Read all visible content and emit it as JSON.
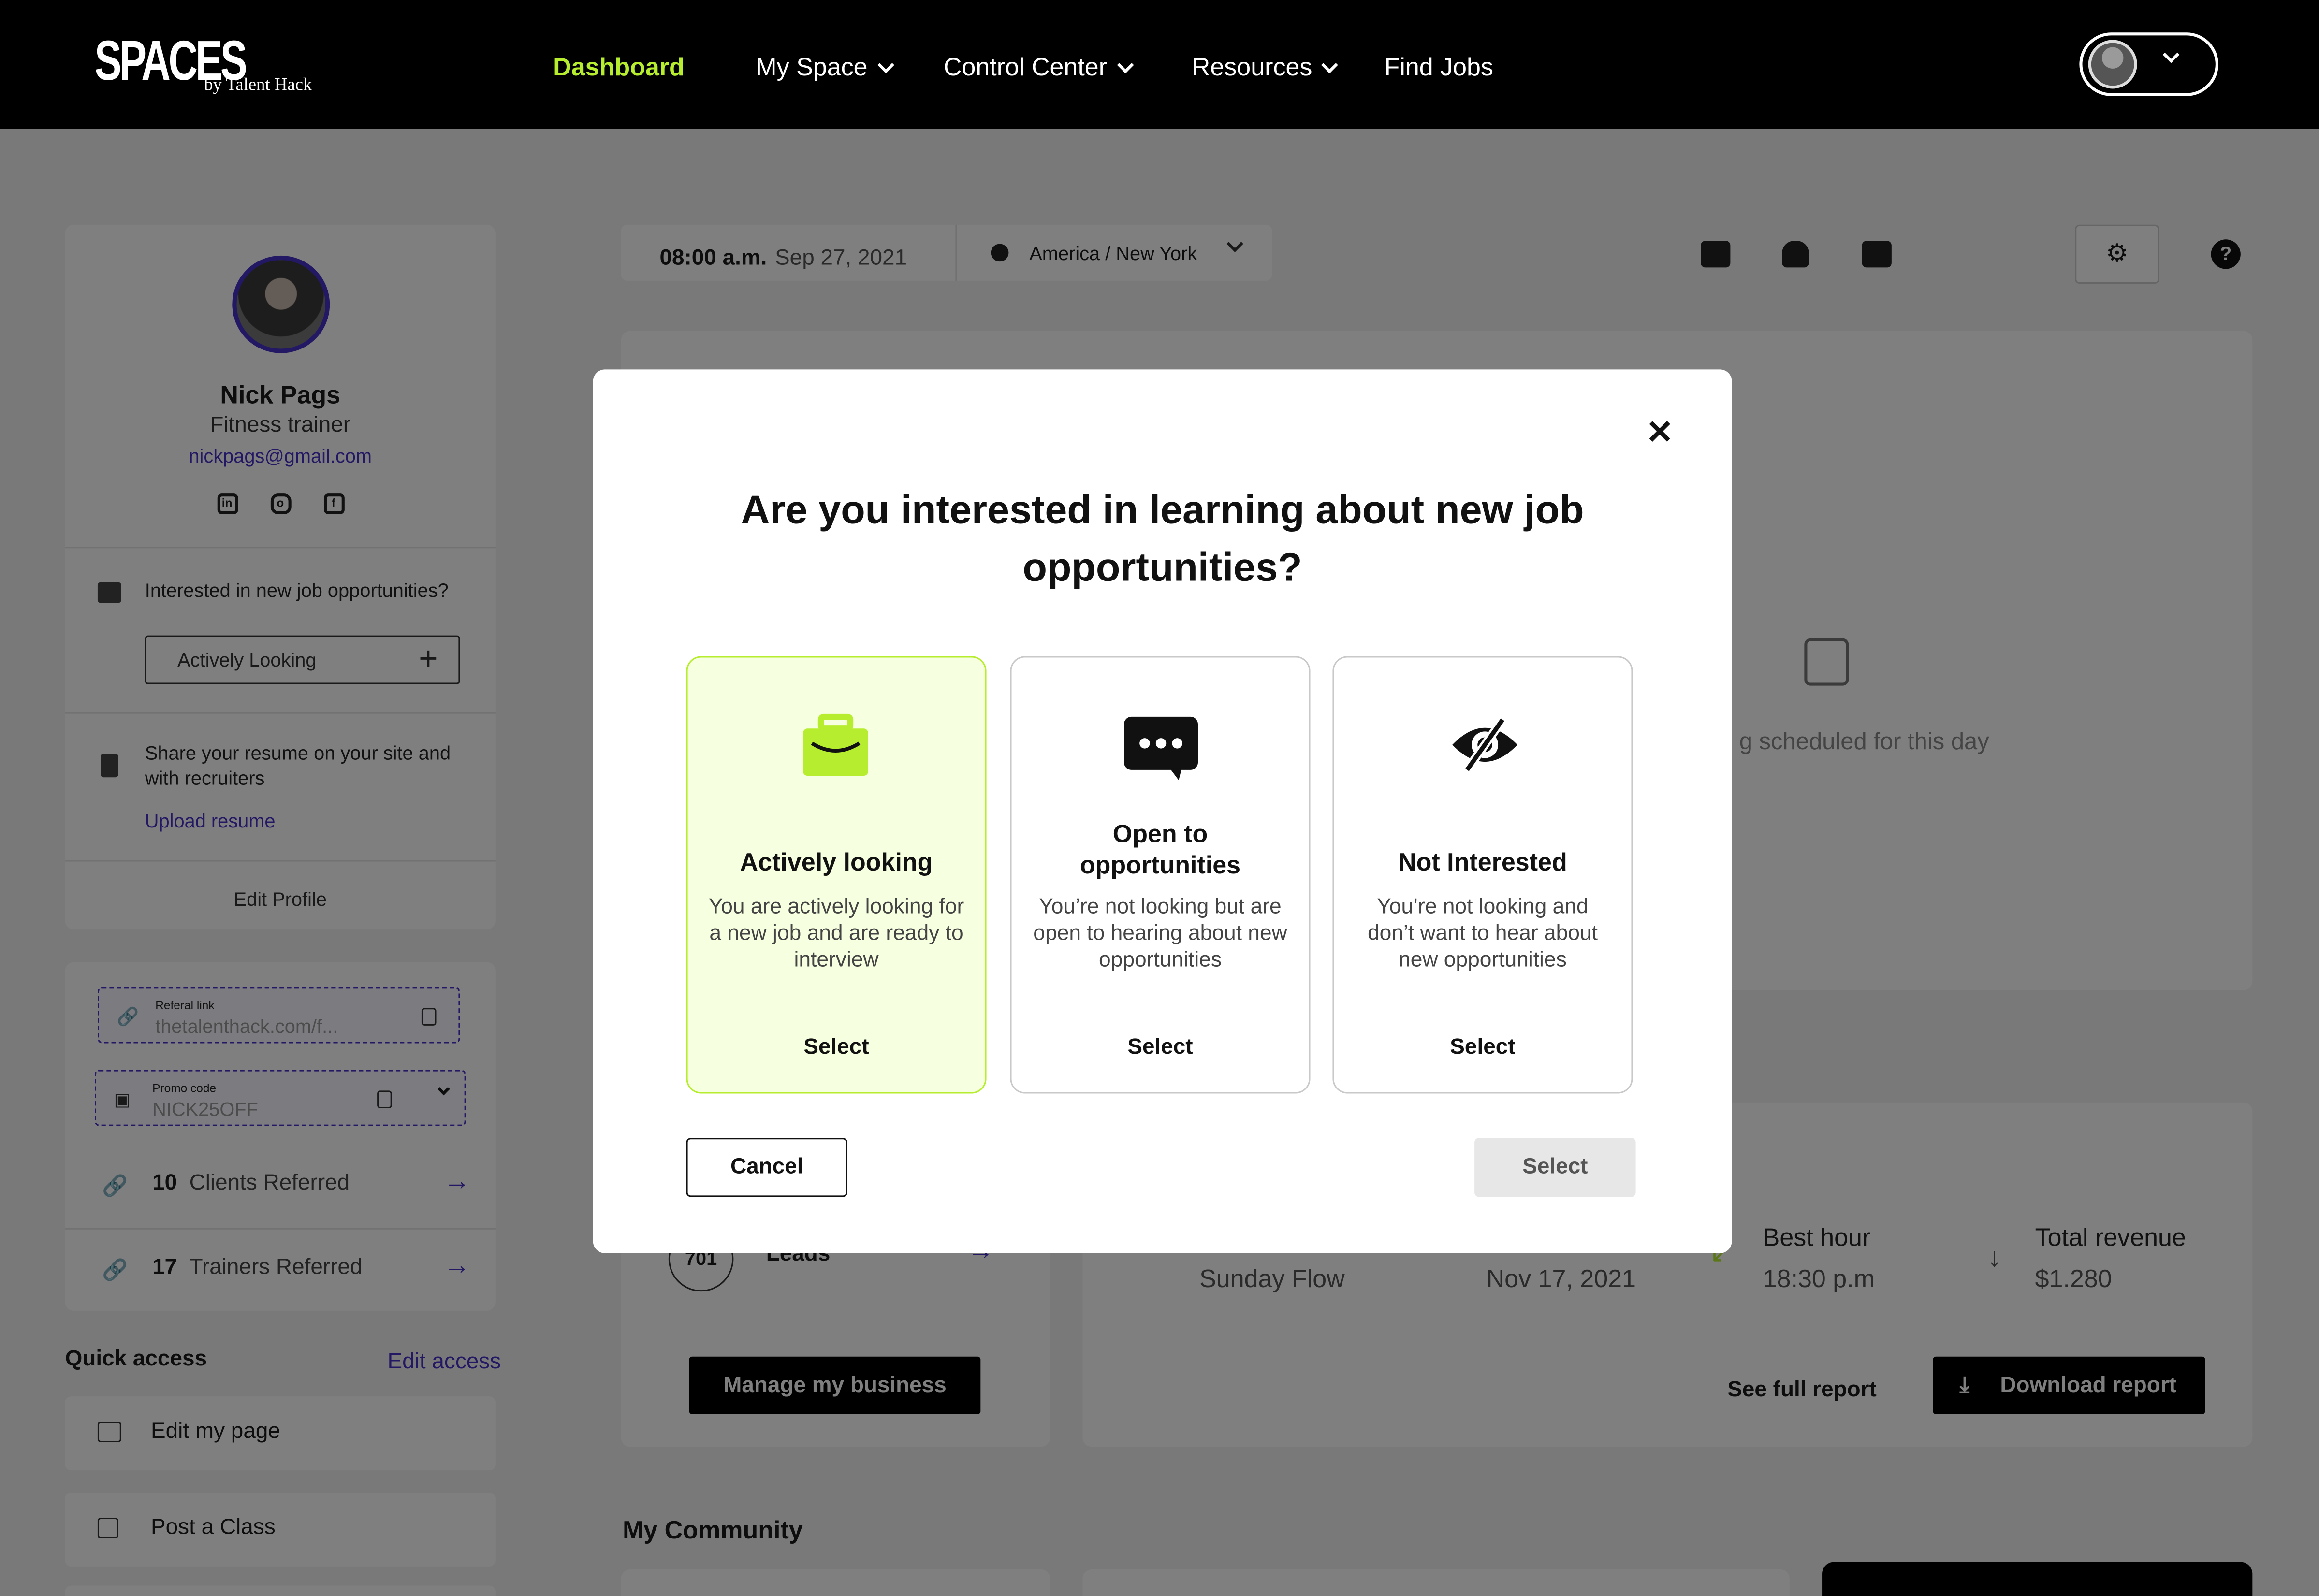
{
  "brand": {
    "logo": "SPACES",
    "tagline": "by Talent Hack",
    "accent": "#b6ee2f",
    "link_color": "#4631c9"
  },
  "nav": {
    "items": [
      {
        "label": "Dashboard",
        "active": true
      },
      {
        "label": "My Space",
        "dropdown": true
      },
      {
        "label": "Control Center",
        "dropdown": true
      },
      {
        "label": "Resources",
        "dropdown": true
      },
      {
        "label": "Find Jobs"
      }
    ]
  },
  "profile": {
    "name": "Nick Pags",
    "role": "Fitness trainer",
    "email": "nickpags@gmail.com",
    "socials": [
      "linkedin-icon",
      "instagram-icon",
      "facebook-icon"
    ],
    "job_question": "Interested in new job opportunities?",
    "job_status": "Actively Looking",
    "resume_text": "Share your resume on your site and with recruiters",
    "upload_label": "Upload resume",
    "edit_label": "Edit Profile"
  },
  "referral": {
    "link_label": "Referal link",
    "link_value": "thetalenthack.com/f...",
    "promo_label": "Promo code",
    "promo_value": "NICK25OFF",
    "clients_count": "10",
    "clients_label": "Clients Referred",
    "trainers_count": "17",
    "trainers_label": "Trainers Referred"
  },
  "quick_access": {
    "title": "Quick access",
    "edit_label": "Edit access",
    "items": [
      "Edit my page",
      "Post a Class"
    ]
  },
  "datetime": {
    "time": "08:00 a.m.",
    "date": "Sep 27, 2021",
    "timezone": "America / New York"
  },
  "schedule": {
    "empty_text": "g scheduled for this day"
  },
  "business": {
    "leads_count": "701",
    "leads_label": "Leads",
    "manage_label": "Manage my business"
  },
  "stats": {
    "class_value": "Sunday Flow",
    "day_value": "Nov 17, 2021",
    "best_hour_label": "Best hour",
    "best_hour_value": "18:30 p.m",
    "revenue_label": "Total revenue",
    "revenue_value": "$1.280",
    "see_report": "See full report",
    "download_report": "Download report"
  },
  "community": {
    "title": "My Community"
  },
  "modal": {
    "title": "Are you interested in learning about new job opportunities?",
    "options": [
      {
        "title": "Actively looking",
        "description": "You are actively looking for a new job and are ready to interview",
        "select": "Select",
        "selected": true,
        "icon": "briefcase-icon"
      },
      {
        "title": "Open to opportunities",
        "description": "You’re not looking but are open to hearing about new opportunities",
        "select": "Select",
        "selected": false,
        "icon": "chat-bubble-icon"
      },
      {
        "title": "Not Interested",
        "description": "You’re not looking and don’t want to hear about new opportunities",
        "select": "Select",
        "selected": false,
        "icon": "eye-off-icon"
      }
    ],
    "cancel_label": "Cancel",
    "select_label": "Select",
    "close_icon": "close-icon"
  }
}
